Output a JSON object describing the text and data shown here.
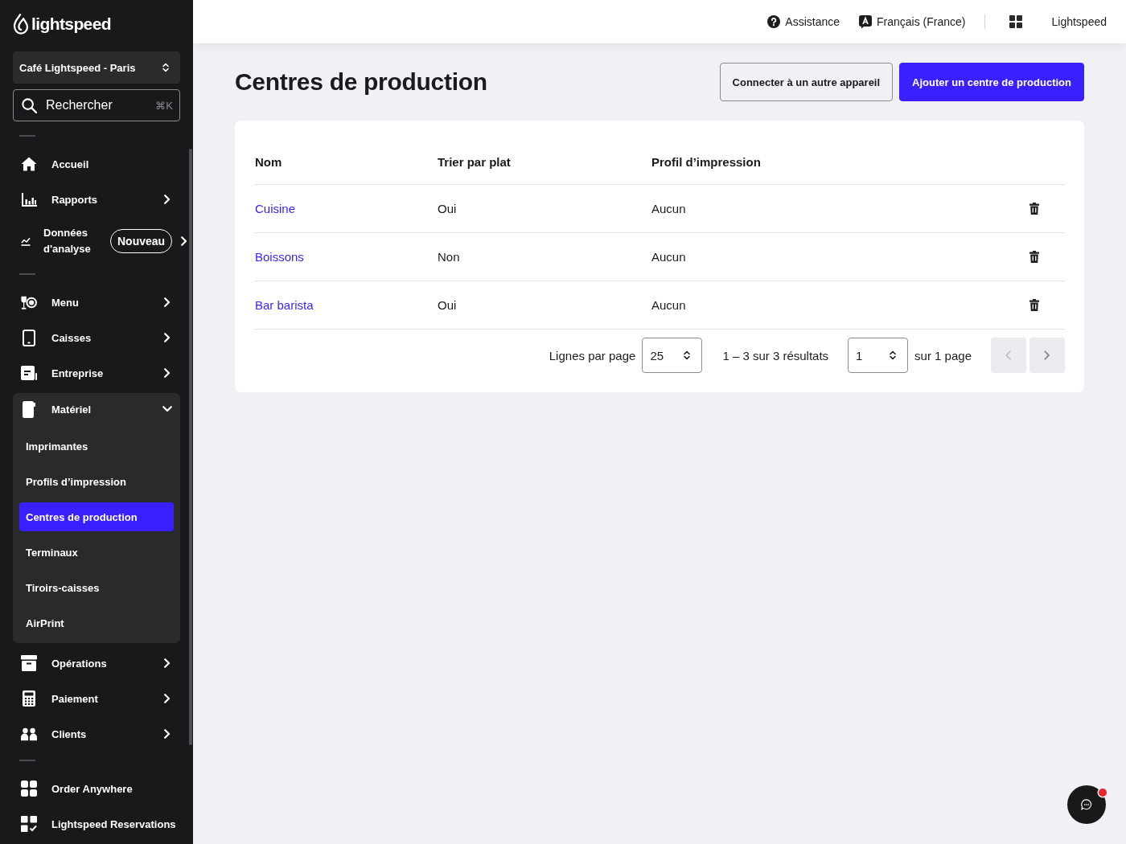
{
  "sidebar": {
    "logo": "lightspeed",
    "location": "Café Lightspeed - Paris",
    "search": {
      "label": "Rechercher",
      "shortcut": "⌘K"
    },
    "sections": [
      {
        "items": [
          {
            "label": "Accueil",
            "kind": "link"
          },
          {
            "label": "Rapports",
            "kind": "group",
            "expanded": false
          },
          {
            "label": "Données d'analyse",
            "kind": "group",
            "expanded": false,
            "badge": "Nouveau"
          }
        ]
      },
      {
        "items": [
          {
            "label": "Menu",
            "kind": "group",
            "expanded": false
          },
          {
            "label": "Caisses",
            "kind": "group",
            "expanded": false
          },
          {
            "label": "Entreprise",
            "kind": "group",
            "expanded": false
          },
          {
            "label": "Matériel",
            "kind": "group",
            "expanded": true,
            "children": [
              {
                "label": "Imprimantes",
                "selected": false
              },
              {
                "label": "Profils d’impression",
                "selected": false
              },
              {
                "label": "Centres de production",
                "selected": true
              },
              {
                "label": "Terminaux",
                "selected": false
              },
              {
                "label": "Tiroirs-caisses",
                "selected": false
              },
              {
                "label": "AirPrint",
                "selected": false
              }
            ]
          },
          {
            "label": "Opérations",
            "kind": "group",
            "expanded": false
          },
          {
            "label": "Paiement",
            "kind": "group",
            "expanded": false
          },
          {
            "label": "Clients",
            "kind": "group",
            "expanded": false
          }
        ]
      },
      {
        "items": [
          {
            "label": "Order Anywhere",
            "kind": "link"
          },
          {
            "label": "Lightspeed Reservations",
            "kind": "link"
          }
        ]
      }
    ]
  },
  "top_bar": {
    "links": [
      {
        "label": "Assistance"
      },
      {
        "label": "Français (France)"
      }
    ],
    "account": "Lightspeed"
  },
  "page": {
    "title": "Centres de production",
    "actions": [
      {
        "label": "Connecter à un autre appareil",
        "kind": "secondary"
      },
      {
        "label": "Ajouter un centre de production",
        "kind": "primary"
      }
    ]
  },
  "table": {
    "columns": [
      "Nom",
      "Trier par plat",
      "Profil d’impression"
    ],
    "rows": [
      {
        "cells": [
          "Cuisine",
          "Oui",
          "Aucun"
        ]
      },
      {
        "cells": [
          "Boissons",
          "Non",
          "Aucun"
        ]
      },
      {
        "cells": [
          "Bar barista",
          "Oui",
          "Aucun"
        ]
      }
    ]
  },
  "pagination": {
    "rows_per_page_label": "Lignes par page",
    "rows_per_page": "25",
    "summary": "1 – 3 sur 3 résultats",
    "page": "1",
    "page_label": "sur 1 page",
    "previous": {
      "disabled": true
    },
    "next": {
      "disabled": false
    }
  },
  "chat": {
    "unread": true
  }
}
